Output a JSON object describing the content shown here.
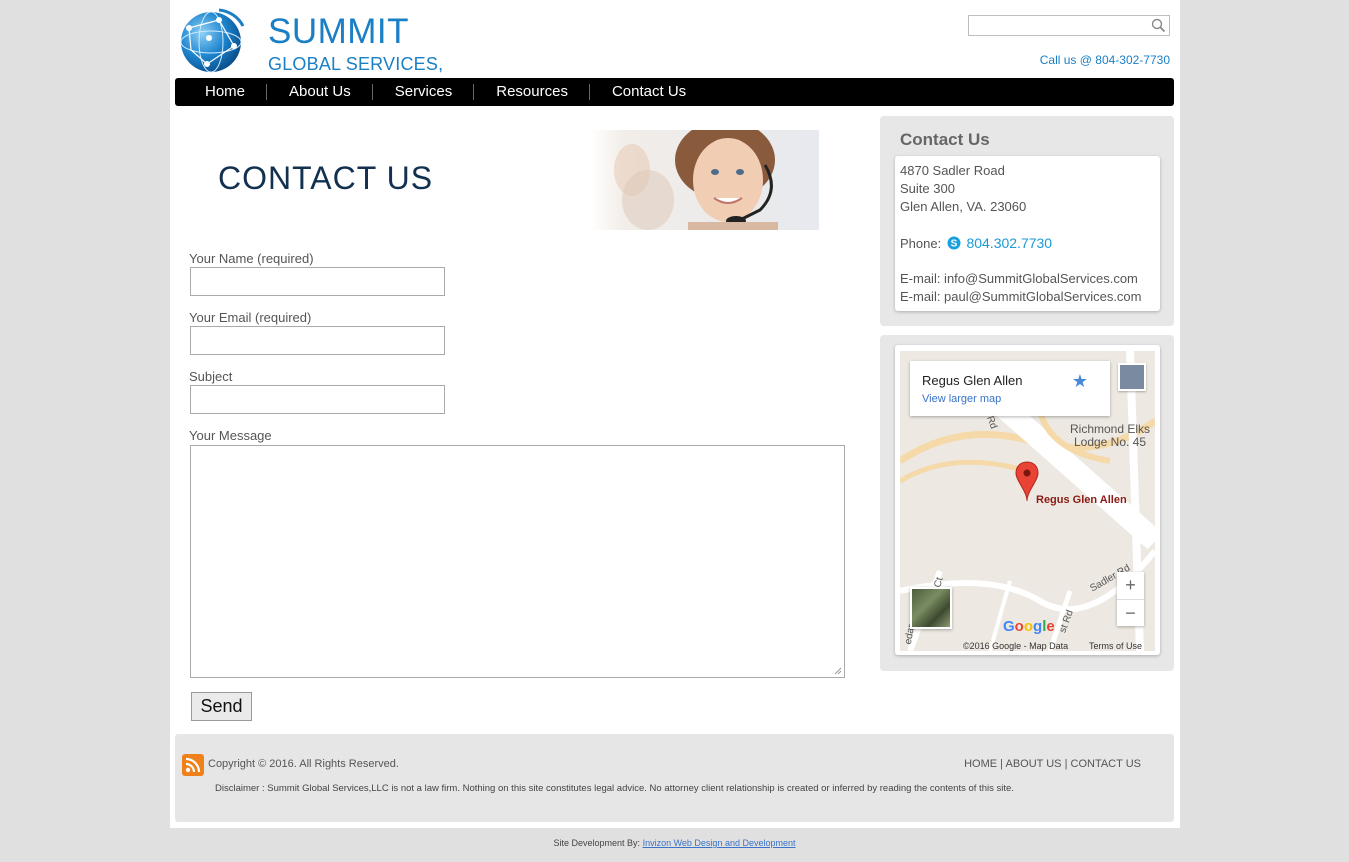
{
  "header": {
    "brand_line1": "SUMMIT",
    "brand_line2": "GLOBAL SERVICES, LLC",
    "search_placeholder": "",
    "call_us": "Call us @ 804-302-7730"
  },
  "nav": {
    "items": [
      "Home",
      "About Us",
      "Services",
      "Resources",
      "Contact Us"
    ]
  },
  "main": {
    "hero_title": "CONTACT US",
    "form": {
      "name_label": "Your Name (required)",
      "email_label": "Your Email (required)",
      "subject_label": "Subject",
      "message_label": "Your Message",
      "send_label": "Send",
      "name_value": "",
      "email_value": "",
      "subject_value": "",
      "message_value": ""
    }
  },
  "sidebar": {
    "contact_title": "Contact Us",
    "address1": "4870 Sadler Road",
    "address2": "Suite 300",
    "address3": "Glen Allen, VA. 23060",
    "phone_label": "Phone:",
    "phone_number": "804.302.7730",
    "email1": "E-mail: info@SummitGlobalServices.com",
    "email2": "E-mail: paul@SummitGlobalServices.com"
  },
  "map": {
    "place_name": "Regus Glen Allen",
    "view_larger": "View larger map",
    "label_elks": "Richmond Elks Lodge No. 45",
    "label_regus": "Regus Glen Allen",
    "zoom_in": "+",
    "zoom_out": "−",
    "google": "Google",
    "copyright": "©2016 Google - Map Data",
    "terms": "Terms of Use",
    "road_sadler": "Sadler Rd",
    "road_st": "st Rd",
    "road_ct": "Ct",
    "road_dar": "edar",
    "road_rd": "Rd"
  },
  "footer": {
    "copyright": "Copyright © 2016. All Rights Reserved.",
    "link_home": "HOME",
    "link_about": "ABOUT US",
    "link_contact": "CONTACT US",
    "separator": "|",
    "disclaimer": "Disclaimer : Summit Global Services,LLC is not a law firm. Nothing on this site constitutes legal advice. No attorney client relationship is created or inferred by reading the contents of this site.",
    "credit_prefix": "Site Development By:",
    "credit_link": "Invizon Web Design and Development"
  },
  "colors": {
    "brand_blue": "#1a7fc4",
    "nav_bg": "#000000",
    "page_bg": "#e0e0e0",
    "sidebar_bg": "#e7e7e7",
    "hero_title": "#12304f"
  }
}
